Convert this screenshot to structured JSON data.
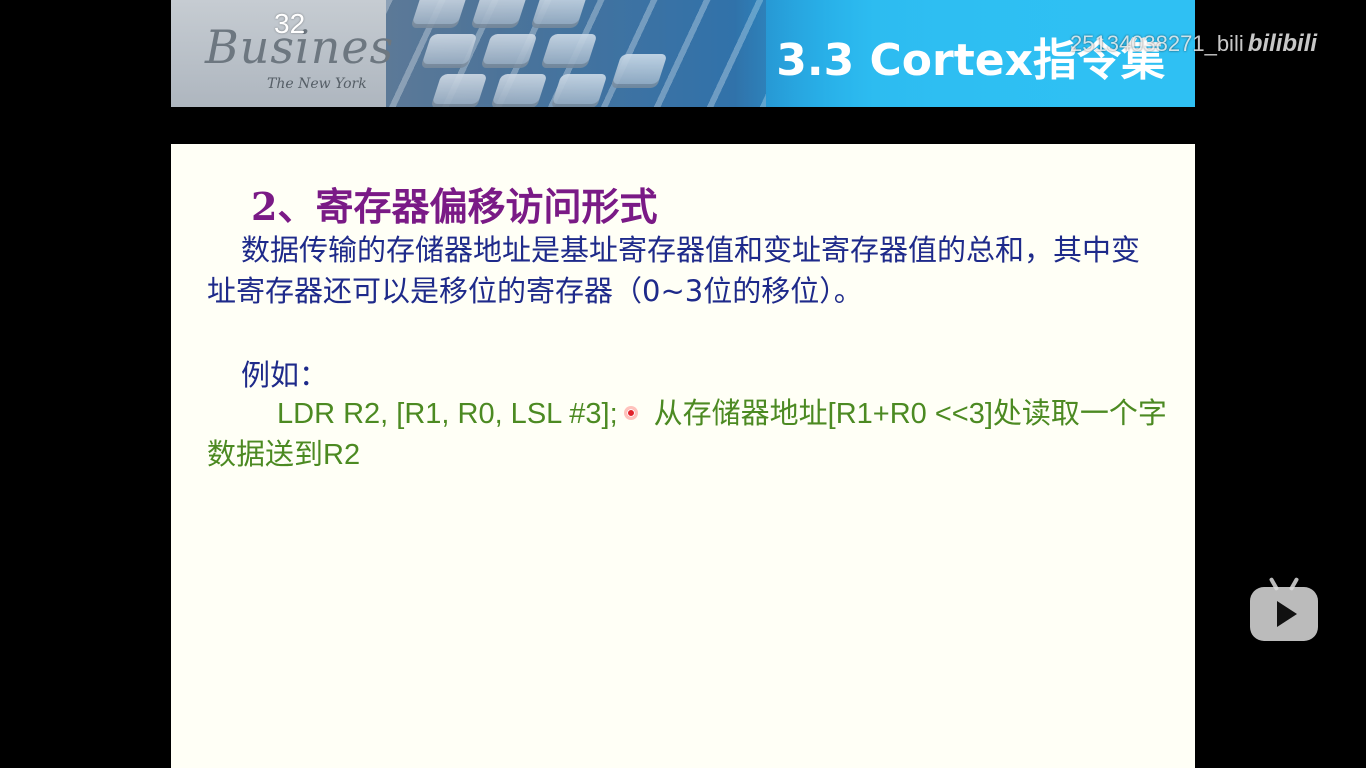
{
  "banner": {
    "slide_number": "32",
    "title": "3.3 Cortex指令集",
    "decor_text": "Busines",
    "decor_subtext": "The New York"
  },
  "slide": {
    "heading": "2、寄存器偏移访问形式",
    "paragraph": "数据传输的存储器地址是基址寄存器值和变址寄存器值的总和，其中变址寄存器还可以是移位的寄存器（0~3位的移位）。",
    "example_label": "例如：",
    "example_code": "LDR R2, [R1, R0, LSL #3];",
    "example_comment": "从存储器地址[R1+R0 <<3]处读取一个字数据送到R2"
  },
  "overlay": {
    "watermark": "25134038271_bili",
    "watermark_logo": "bilibili"
  },
  "colors": {
    "heading": "#7a1a86",
    "body_text": "#1e2a8a",
    "code_text": "#4c8a22",
    "banner_accent": "#2fc0f3"
  },
  "icons": {
    "play_button": "bilibili-tv-play-icon",
    "cursor": "laser-pointer-dot"
  }
}
